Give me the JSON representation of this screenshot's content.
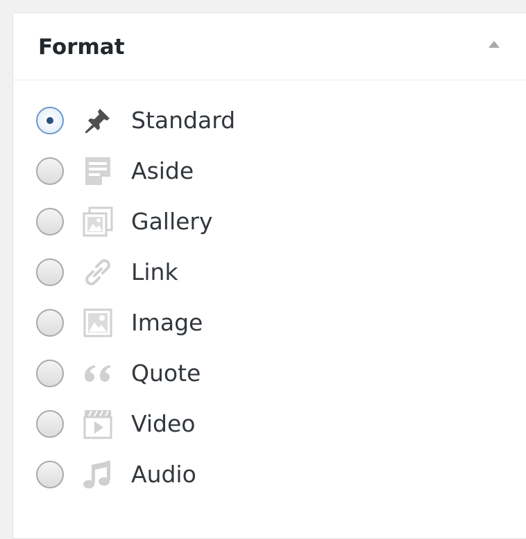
{
  "panel": {
    "title": "Format",
    "collapse_icon": "triangle-up-icon"
  },
  "formats": [
    {
      "label": "Standard",
      "icon": "pin-icon",
      "selected": true
    },
    {
      "label": "Aside",
      "icon": "aside-note-icon",
      "selected": false
    },
    {
      "label": "Gallery",
      "icon": "gallery-icon",
      "selected": false
    },
    {
      "label": "Link",
      "icon": "link-icon",
      "selected": false
    },
    {
      "label": "Image",
      "icon": "image-icon",
      "selected": false
    },
    {
      "label": "Quote",
      "icon": "quote-icon",
      "selected": false
    },
    {
      "label": "Video",
      "icon": "video-icon",
      "selected": false
    },
    {
      "label": "Audio",
      "icon": "audio-icon",
      "selected": false
    }
  ],
  "colors": {
    "selected_icon": "#4f4f4f",
    "unselected_icon": "#cccccc",
    "radio_selected_border": "#6a98c8",
    "radio_dot": "#2c4f7a"
  }
}
